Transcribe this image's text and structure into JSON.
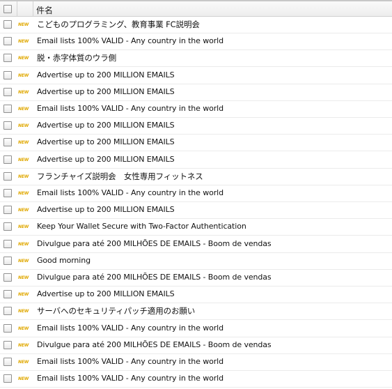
{
  "header": {
    "subject_label": "件名"
  },
  "badge": {
    "label": "NEW",
    "color": "#e0a800"
  },
  "rows": [
    {
      "subject": "こどものプログラミング、教育事業 FC説明会"
    },
    {
      "subject": "Email lists 100% VALID - Any country in the world"
    },
    {
      "subject": "脱・赤字体質のウラ側"
    },
    {
      "subject": "Advertise up to 200 MILLION EMAILS"
    },
    {
      "subject": "Advertise up to 200 MILLION EMAILS"
    },
    {
      "subject": "Email lists 100% VALID - Any country in the world"
    },
    {
      "subject": "Advertise up to 200 MILLION EMAILS"
    },
    {
      "subject": "Advertise up to 200 MILLION EMAILS"
    },
    {
      "subject": "Advertise up to 200 MILLION EMAILS"
    },
    {
      "subject": "フランチャイズ説明会　女性専用フィットネス"
    },
    {
      "subject": "Email lists 100% VALID - Any country in the world"
    },
    {
      "subject": "Advertise up to 200 MILLION EMAILS"
    },
    {
      "subject": "Keep Your Wallet Secure with Two-Factor Authentication"
    },
    {
      "subject": "Divulgue para até 200 MILHÕES DE EMAILS - Boom de vendas"
    },
    {
      "subject": "Good morning"
    },
    {
      "subject": "Divulgue para até 200 MILHÕES DE EMAILS - Boom de vendas"
    },
    {
      "subject": "Advertise up to 200 MILLION EMAILS"
    },
    {
      "subject": "サーバへのセキュリティパッチ適用のお願い"
    },
    {
      "subject": "Email lists 100% VALID - Any country in the world"
    },
    {
      "subject": "Divulgue para até 200 MILHÕES DE EMAILS - Boom de vendas"
    },
    {
      "subject": "Email lists 100% VALID - Any country in the world"
    },
    {
      "subject": "Email lists 100% VALID - Any country in the world"
    }
  ]
}
